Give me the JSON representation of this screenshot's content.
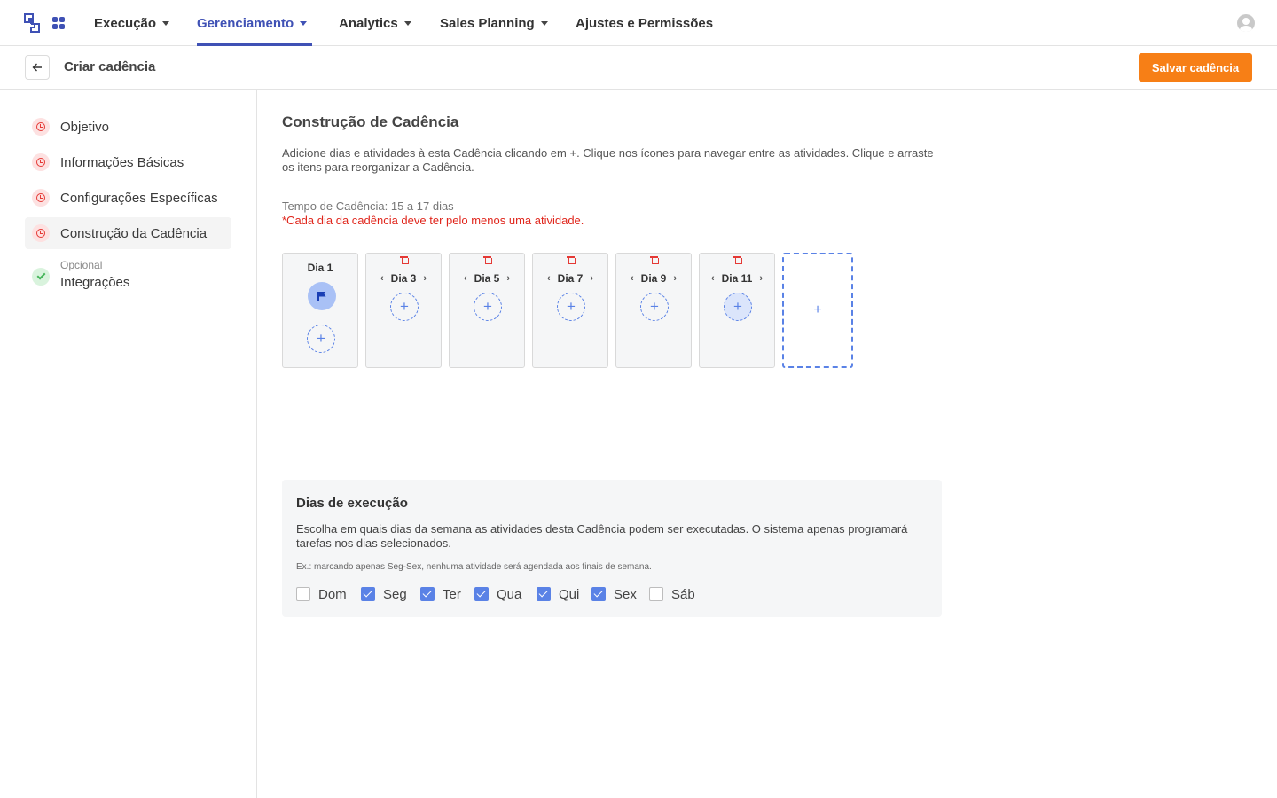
{
  "nav": {
    "items": [
      {
        "label": "Execução",
        "has_caret": true,
        "active": false
      },
      {
        "label": "Gerenciamento",
        "has_caret": true,
        "active": true
      },
      {
        "label": "Analytics",
        "has_caret": true,
        "active": false
      },
      {
        "label": "Sales Planning",
        "has_caret": true,
        "active": false
      },
      {
        "label": "Ajustes e Permissões",
        "has_caret": false,
        "active": false
      }
    ],
    "accent_color": "#3f51b5"
  },
  "subheader": {
    "title": "Criar cadência",
    "save_label": "Salvar cadência",
    "save_color": "#f77f16"
  },
  "sidebar": {
    "steps": [
      {
        "label": "Objetivo",
        "status": "pending",
        "sub": ""
      },
      {
        "label": "Informações Básicas",
        "status": "pending",
        "sub": ""
      },
      {
        "label": "Configurações Específicas",
        "status": "pending",
        "sub": ""
      },
      {
        "label": "Construção da Cadência",
        "status": "pending",
        "sub": "",
        "active": true
      },
      {
        "label": "Integrações",
        "status": "done",
        "sub": "Opcional"
      }
    ]
  },
  "builder": {
    "title": "Construção de Cadência",
    "description": "Adicione dias e atividades à esta Cadência clicando em +. Clique nos ícones para navegar entre as atividades. Clique e arraste os itens para reorganizar a Cadência.",
    "duration": "Tempo de Cadência: 15 a 17 dias",
    "warning": "*Cada dia da cadência deve ter pelo menos uma atividade.",
    "days": [
      {
        "label": "Dia 1",
        "icon": "flag-icon"
      },
      {
        "label": "Dia 3"
      },
      {
        "label": "Dia 5"
      },
      {
        "label": "Dia 7"
      },
      {
        "label": "Dia 9"
      },
      {
        "label": "Dia 11"
      }
    ],
    "add_day_symbol": "+",
    "add_activity_symbol": "+",
    "prev_symbol": "‹",
    "next_symbol": "›"
  },
  "execution": {
    "title": "Dias de execução",
    "description": "Escolha em quais dias da semana as atividades desta Cadência podem ser executadas. O sistema apenas programará tarefas nos dias selecionados.",
    "example": "Ex.: marcando apenas Seg-Sex, nenhuma atividade será agendada aos finais de semana.",
    "weekdays": [
      {
        "label": "Dom",
        "checked": false
      },
      {
        "label": "Seg",
        "checked": true
      },
      {
        "label": "Ter",
        "checked": true
      },
      {
        "label": "Qua",
        "checked": true
      },
      {
        "label": "Qui",
        "checked": true
      },
      {
        "label": "Sex",
        "checked": true
      },
      {
        "label": "Sáb",
        "checked": false
      }
    ]
  }
}
